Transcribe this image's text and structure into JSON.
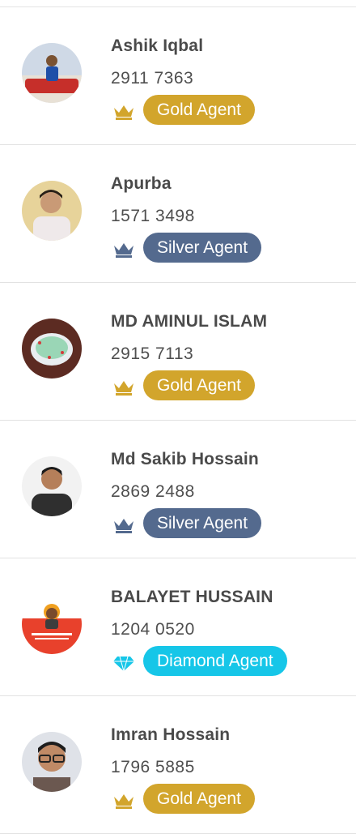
{
  "agents": [
    {
      "name": "Ashik Iqbal",
      "phone": "2911 7363",
      "tier": "Gold Agent",
      "tier_key": "gold",
      "icon": "crown-icon"
    },
    {
      "name": "Apurba",
      "phone": "1571 3498",
      "tier": "Silver Agent",
      "tier_key": "silver",
      "icon": "crown-icon"
    },
    {
      "name": "MD AMINUL ISLAM",
      "phone": "2915 7113",
      "tier": "Gold Agent",
      "tier_key": "gold",
      "icon": "crown-icon"
    },
    {
      "name": "Md Sakib Hossain",
      "phone": "2869 2488",
      "tier": "Silver Agent",
      "tier_key": "silver",
      "icon": "crown-icon"
    },
    {
      "name": "BALAYET HUSSAIN",
      "phone": "1204 0520",
      "tier": "Diamond Agent",
      "tier_key": "diamond",
      "icon": "diamond-icon"
    },
    {
      "name": "Imran Hossain",
      "phone": "1796 5885",
      "tier": "Gold Agent",
      "tier_key": "gold",
      "icon": "crown-icon"
    }
  ],
  "colors": {
    "gold": "#d2a52c",
    "silver": "#546a8e",
    "diamond": "#16c6e8"
  }
}
